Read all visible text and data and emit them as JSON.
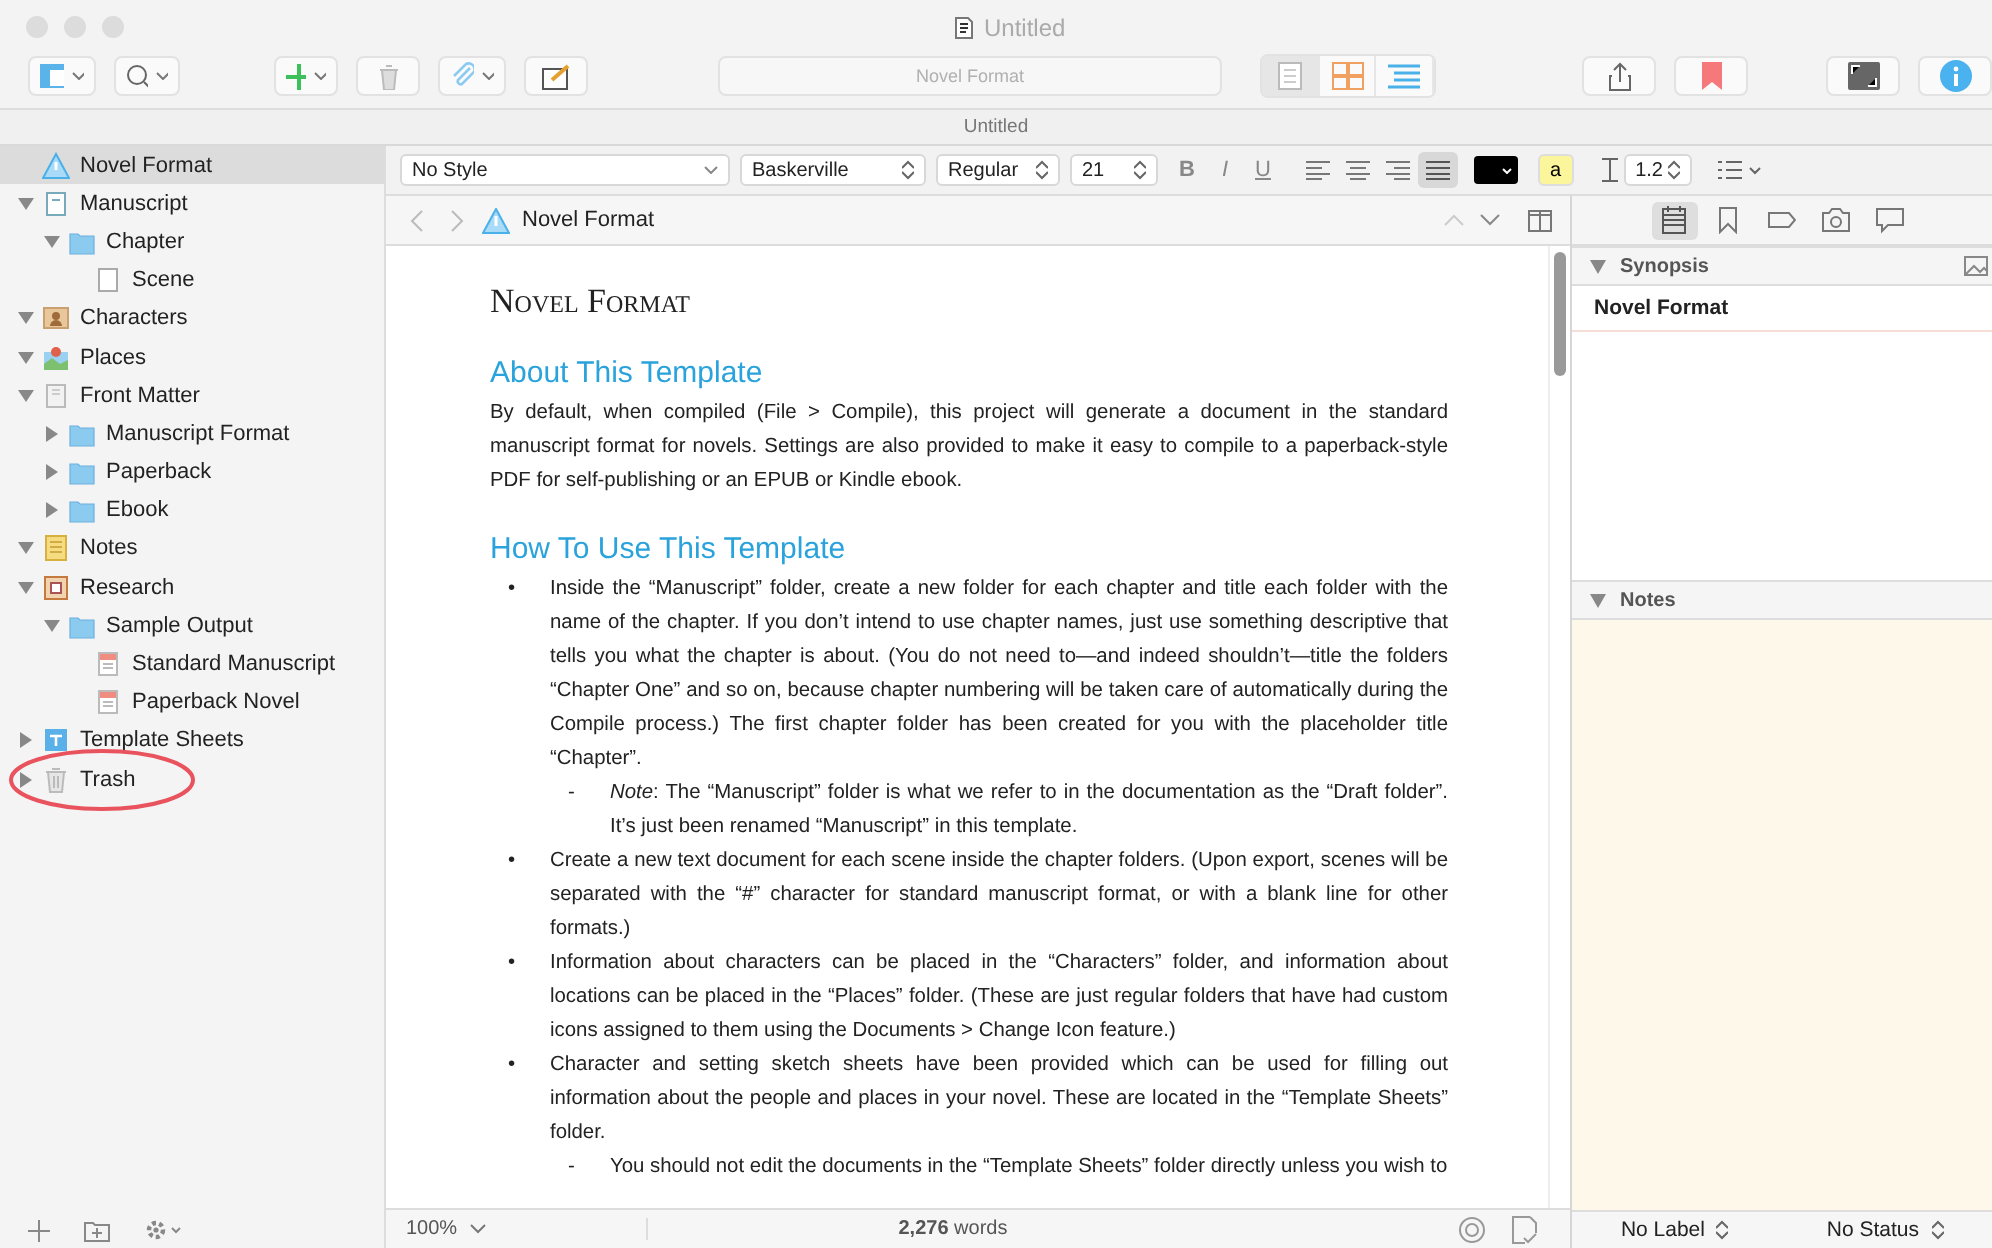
{
  "window": {
    "title": "Untitled",
    "tab": "Untitled"
  },
  "toolbar": {
    "location": "Novel Format",
    "view_modes": [
      {
        "kind": "document",
        "selected": true
      },
      {
        "kind": "corkboard",
        "selected": false
      },
      {
        "kind": "outliner",
        "selected": false
      }
    ]
  },
  "binder": {
    "items": [
      {
        "label": "Novel Format",
        "kind": "warning",
        "selected": true
      },
      {
        "label": "Manuscript",
        "kind": "draft",
        "selected": false,
        "expanded": true,
        "children": [
          {
            "label": "Chapter",
            "kind": "folder",
            "selected": false,
            "expanded": true,
            "children": [
              {
                "label": "Scene",
                "kind": "page",
                "selected": false
              }
            ]
          }
        ]
      },
      {
        "label": "Characters",
        "kind": "characters",
        "selected": false,
        "expanded": true
      },
      {
        "label": "Places",
        "kind": "places",
        "selected": false,
        "expanded": true
      },
      {
        "label": "Front Matter",
        "kind": "frontmatter",
        "selected": false,
        "expanded": true,
        "children": [
          {
            "label": "Manuscript Format",
            "kind": "folder",
            "selected": false,
            "expanded": false
          },
          {
            "label": "Paperback",
            "kind": "folder",
            "selected": false,
            "expanded": false
          },
          {
            "label": "Ebook",
            "kind": "folder",
            "selected": false,
            "expanded": false
          }
        ]
      },
      {
        "label": "Notes",
        "kind": "notes",
        "selected": false,
        "expanded": true
      },
      {
        "label": "Research",
        "kind": "research",
        "selected": false,
        "expanded": true,
        "children": [
          {
            "label": "Sample Output",
            "kind": "folder",
            "selected": false,
            "expanded": true,
            "children": [
              {
                "label": "Standard Manuscript",
                "kind": "pdf",
                "selected": false
              },
              {
                "label": "Paperback Novel",
                "kind": "pdf",
                "selected": false
              }
            ]
          }
        ]
      },
      {
        "label": "Template Sheets",
        "kind": "templates",
        "selected": false,
        "expanded": false
      },
      {
        "label": "Trash",
        "kind": "trash",
        "selected": false,
        "expanded": false
      }
    ]
  },
  "format_bar": {
    "style": "No Style",
    "font": "Baskerville",
    "weight": "Regular",
    "size": "21",
    "text_buttons": [
      "B",
      "I",
      "U"
    ],
    "alignments": [
      {
        "kind": "left",
        "selected": false
      },
      {
        "kind": "center",
        "selected": false
      },
      {
        "kind": "right",
        "selected": false
      },
      {
        "kind": "justify",
        "selected": true
      }
    ],
    "highlight": "a",
    "line_spacing": "1.2"
  },
  "editor": {
    "header_title": "Novel Format",
    "document": {
      "title": "Novel Format",
      "sections": [
        {
          "heading": "About This Template",
          "paragraphs": [
            "By default, when compiled (File > Compile), this project will generate a document in the standard manuscript format for novels. Settings are also provided to make it easy to compile to a paperback-style PDF for self-publishing or an EPUB or Kindle ebook."
          ]
        },
        {
          "heading": "How To Use This Template",
          "list": [
            {
              "marker": "•",
              "text": "Inside the “Manuscript” folder, create a new folder for each chapter and title each folder with the name of the chapter. If you don’t intend to use chapter names, just use something descriptive that tells you what the chapter is about. (You do not need to—and indeed shouldn’t—title the folders “Chapter One” and so on, because chapter numbering will be taken care of automatically during the Compile process.) The first chapter folder has been created for you with the placeholder title “Chapter”.",
              "children": [
                {
                  "marker": "-",
                  "text": "*Note*: The “Manuscript” folder is what we refer to in the documentation as the “Draft folder”. It’s just been renamed “Manuscript” in this template."
                }
              ]
            },
            {
              "marker": "•",
              "text": "Create a new text document for each scene inside the chapter folders. (Upon export, scenes will be separated with the “#” character for standard manuscript format, or with a blank line for other formats.)"
            },
            {
              "marker": "•",
              "text": "Information about characters can be placed in the “Characters” folder, and information about locations can be placed in the “Places” folder. (These are just regular folders that have had custom icons assigned to them using the Documents > Change Icon feature.)"
            },
            {
              "marker": "•",
              "text": "Character and setting sketch sheets have been provided which can be used for filling out information about the people and places in your novel. These are located in the “Template Sheets” folder.",
              "children": [
                {
                  "marker": "-",
                  "text": "You should not edit the documents in the “Template Sheets” folder directly unless you wish to"
                }
              ]
            }
          ]
        }
      ]
    },
    "zoom": "100%",
    "word_count": "**2,276** words"
  },
  "inspector": {
    "tabs": [
      {
        "kind": "notecard",
        "selected": true
      },
      {
        "kind": "bookmark",
        "selected": false
      },
      {
        "kind": "tag",
        "selected": false
      },
      {
        "kind": "camera",
        "selected": false
      },
      {
        "kind": "comment",
        "selected": false
      }
    ],
    "synopsis_header": "Synopsis",
    "synopsis_title": "Novel Format",
    "notes_header": "Notes",
    "label": "No Label",
    "status": "No Status"
  }
}
